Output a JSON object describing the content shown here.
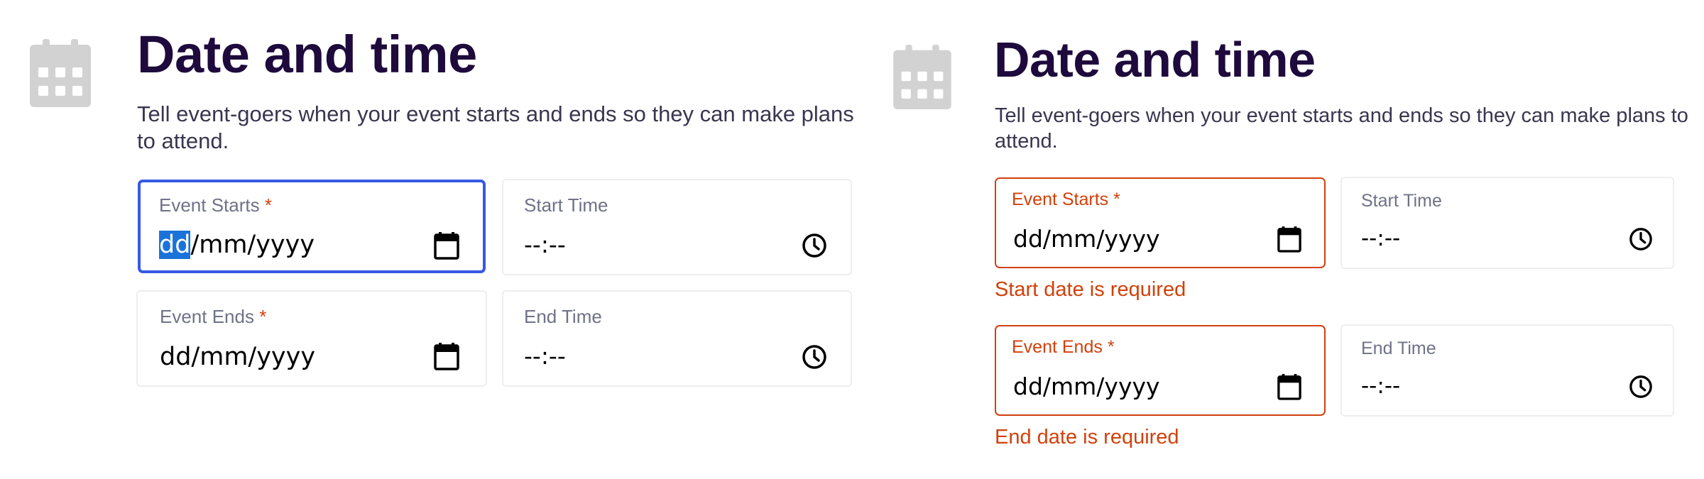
{
  "colors": {
    "heading": "#1e0a3c",
    "focus_border": "#3659e3",
    "error": "#d1410c",
    "label": "#6f7287",
    "selection": "#1a73d9"
  },
  "panels": [
    {
      "state": "focused",
      "icon": "calendar-icon",
      "heading": "Date and time",
      "description": "Tell event-goers when your event starts and ends so they can make plans to attend.",
      "fields": {
        "event_starts": {
          "label": "Event Starts",
          "required_mark": "*",
          "value_selected": "dd",
          "value_rest": "/mm/yyyy",
          "icon": "calendar-picker-icon"
        },
        "start_time": {
          "label": "Start Time",
          "value": "--:--",
          "icon": "clock-icon"
        },
        "event_ends": {
          "label": "Event Ends",
          "required_mark": "*",
          "value": "dd/mm/yyyy",
          "icon": "calendar-picker-icon"
        },
        "end_time": {
          "label": "End Time",
          "value": "--:--",
          "icon": "clock-icon"
        }
      }
    },
    {
      "state": "error",
      "icon": "calendar-icon",
      "heading": "Date and time",
      "description": "Tell event-goers when your event starts and ends so they can make plans to attend.",
      "fields": {
        "event_starts": {
          "label": "Event Starts",
          "required_mark": "*",
          "value": "dd/mm/yyyy",
          "icon": "calendar-picker-icon",
          "error": "Start date is required"
        },
        "start_time": {
          "label": "Start Time",
          "value": "--:--",
          "icon": "clock-icon"
        },
        "event_ends": {
          "label": "Event Ends",
          "required_mark": "*",
          "value": "dd/mm/yyyy",
          "icon": "calendar-picker-icon",
          "error": "End date is required"
        },
        "end_time": {
          "label": "End Time",
          "value": "--:--",
          "icon": "clock-icon"
        }
      }
    }
  ]
}
